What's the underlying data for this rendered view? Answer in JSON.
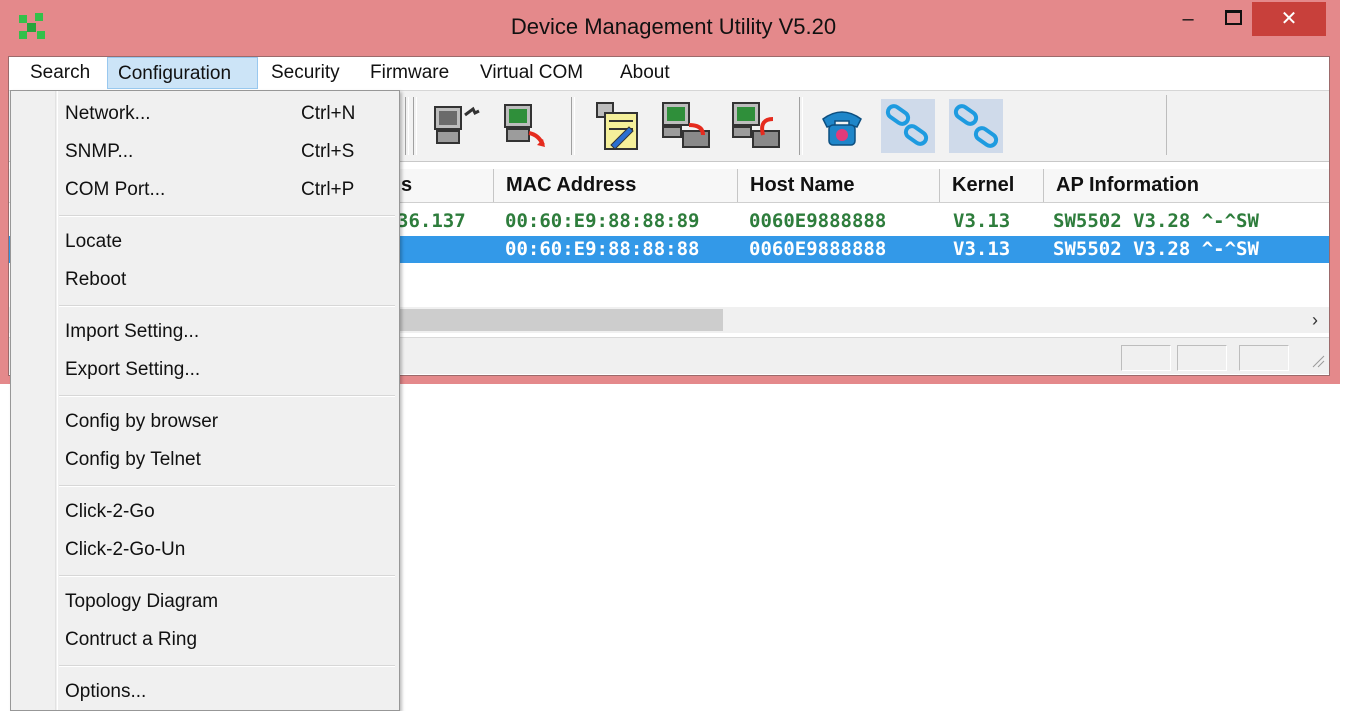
{
  "window": {
    "title": "Device Management Utility V5.20"
  },
  "menubar": {
    "items": [
      {
        "label": "Search"
      },
      {
        "label": "Configuration"
      },
      {
        "label": "Security"
      },
      {
        "label": "Firmware"
      },
      {
        "label": "Virtual COM"
      },
      {
        "label": "About"
      }
    ]
  },
  "dropdown": {
    "items": [
      {
        "label": "Network...",
        "shortcut": "Ctrl+N"
      },
      {
        "label": "SNMP...",
        "shortcut": "Ctrl+S"
      },
      {
        "label": "COM Port...",
        "shortcut": "Ctrl+P"
      },
      {
        "label": "Locate"
      },
      {
        "label": "Reboot"
      },
      {
        "label": "Import Setting..."
      },
      {
        "label": "Export Setting..."
      },
      {
        "label": "Config by browser"
      },
      {
        "label": "Config by Telnet"
      },
      {
        "label": "Click-2-Go"
      },
      {
        "label": "Click-2-Go-Un"
      },
      {
        "label": "Topology Diagram"
      },
      {
        "label": "Contruct a Ring"
      },
      {
        "label": "Options..."
      }
    ]
  },
  "table": {
    "columns": [
      "s",
      "MAC Address",
      "Host Name",
      "Kernel",
      "AP Information"
    ],
    "rows": [
      {
        "ip": "36.137",
        "mac": "00:60:E9:88:88:89",
        "host": "0060E9888888",
        "kernel": "V3.13",
        "ap": "SW5502 V3.28 ^-^SW",
        "selected": false
      },
      {
        "ip": "",
        "mac": "00:60:E9:88:88:88",
        "host": "0060E9888888",
        "kernel": "V3.13",
        "ap": "SW5502 V3.28 ^-^SW",
        "selected": true
      }
    ]
  },
  "colors": {
    "titlebar": "#e4898b",
    "close_button": "#c8403b",
    "row_text": "#2e7d3c",
    "selection": "#3399e8",
    "menu_active": "#cce4f7"
  },
  "icons": [
    "app-logo",
    "search-device-icon",
    "reply-device-icon",
    "config-edit-icon",
    "upload-firmware-icon",
    "download-firmware-icon",
    "telephone-icon",
    "link-icon",
    "unlink-icon"
  ]
}
